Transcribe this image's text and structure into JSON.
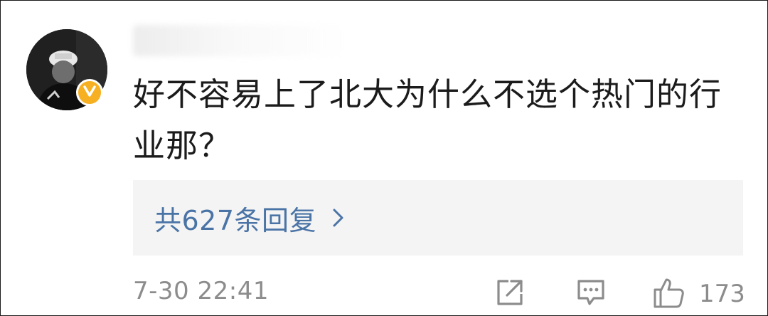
{
  "comment": {
    "text": "好不容易上了北大为什么不选个热门的行业那？",
    "verified_badge": "v-icon",
    "badge_color": "#f6b021"
  },
  "replies": {
    "label": "共627条回复",
    "link_color": "#4a74a6",
    "chevron_icon": "chevron-right-icon"
  },
  "footer": {
    "timestamp": "7-30 22:41",
    "share_icon": "share-icon",
    "comment_icon": "comment-icon",
    "like_icon": "thumbs-up-icon",
    "like_count": "173"
  }
}
